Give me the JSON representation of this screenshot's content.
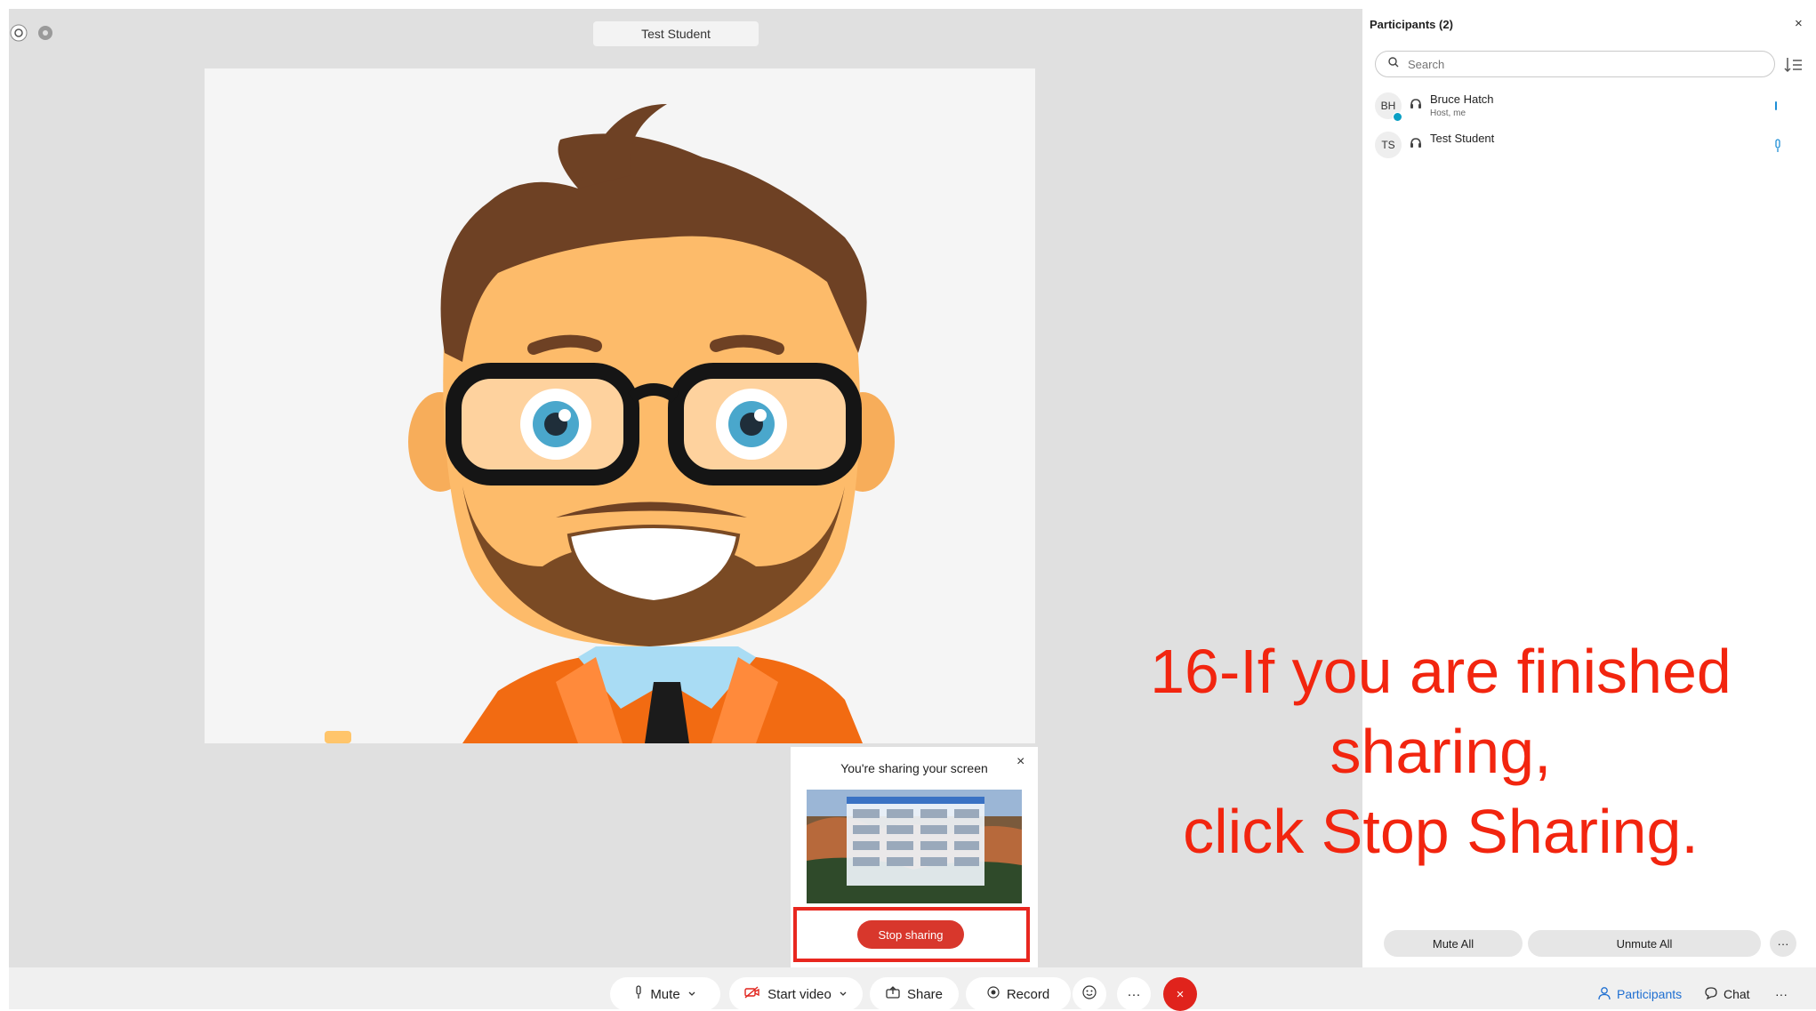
{
  "stage": {
    "participant_name": "Test Student"
  },
  "share_popup": {
    "title": "You're sharing your screen",
    "close": "×",
    "stop_label": "Stop sharing"
  },
  "instruction": {
    "text": "16-If you are finished\nsharing,\nclick Stop Sharing."
  },
  "panel": {
    "title": "Participants (2)",
    "close": "×",
    "search_placeholder": "Search",
    "participants": [
      {
        "initials": "BH",
        "name": "Bruce Hatch",
        "subtitle": "Host, me"
      },
      {
        "initials": "TS",
        "name": "Test Student",
        "subtitle": ""
      }
    ],
    "mute_all": "Mute All",
    "unmute_all": "Unmute All",
    "more": "···"
  },
  "toolbar": {
    "mute": "Mute",
    "start_video": "Start video",
    "share": "Share",
    "record": "Record",
    "more": "···",
    "end": "×",
    "participants": "Participants",
    "chat": "Chat",
    "right_more": "···"
  },
  "colors": {
    "accent_red": "#e0231c",
    "instruction_red": "#f2250f",
    "link_blue": "#1f6fd1"
  }
}
